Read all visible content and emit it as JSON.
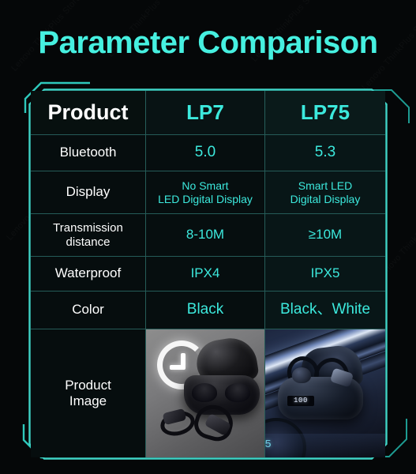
{
  "page": {
    "title": "Parameter Comparison",
    "accent_color": "#3ce9dd",
    "title_color": "#46f0e0",
    "background_color": "#050708",
    "label_color": "#ffffff",
    "border_color": "#50c8be"
  },
  "watermarks": [
    "Lenovo ThinkPlus Store",
    "Lenovo ThinkPlus Store",
    "Lenovo ThinkPlus Store",
    "Lenovo ThinkPlus Store",
    "Lenovo ThinkPlus Store",
    "Lenovo ThinkPlus Store",
    "Lenovo ThinkPlus Store",
    "Lenovo ThinkPlus Store",
    "Lenovo ThinkPlus Store"
  ],
  "table": {
    "columns": [
      {
        "key": "product",
        "label": "Product"
      },
      {
        "key": "lp7",
        "label": "LP7"
      },
      {
        "key": "lp75",
        "label": "LP75"
      }
    ],
    "rows": [
      {
        "key": "bluetooth",
        "label": "Bluetooth",
        "lp7": "5.0",
        "lp75": "5.3"
      },
      {
        "key": "display",
        "label": "Display",
        "lp7_lines": [
          "No Smart",
          "LED Digital Display"
        ],
        "lp75_lines": [
          "Smart LED",
          "Digital Display"
        ]
      },
      {
        "key": "transmission-distance",
        "label_lines": [
          "Transmission",
          "distance"
        ],
        "lp7": "8-10M",
        "lp75": "≥10M"
      },
      {
        "key": "waterproof",
        "label": "Waterproof",
        "lp7": "IPX4",
        "lp75": "IPX5"
      },
      {
        "key": "color",
        "label": "Color",
        "lp7": "Black",
        "lp75": "Black、White"
      },
      {
        "key": "product-image",
        "label_lines": [
          "Product",
          "Image"
        ],
        "lp7_image": "lp7-earbuds-charging-case-photo",
        "lp75_image": "lp75-earhook-earbuds-charging-case-photo"
      }
    ]
  },
  "product_images": {
    "lp7": {
      "alt": "LP7 black charging case open with two earbuds on grey background with glowing ring",
      "background": "#7a7a7c"
    },
    "lp75": {
      "alt": "LP75 black charging case with earhook earbuds and LED display on blue gradient background",
      "background": "#2d3c5c",
      "led_text": "100"
    }
  }
}
